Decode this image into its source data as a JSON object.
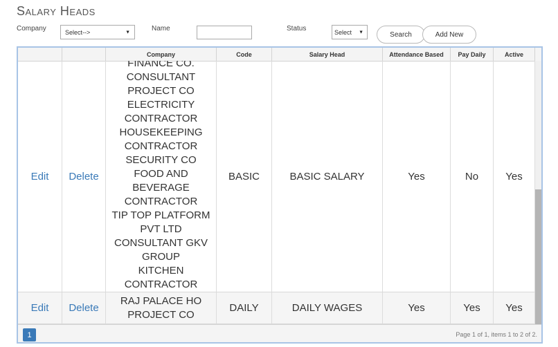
{
  "page": {
    "title": "Salary Heads"
  },
  "filters": {
    "company_label": "Company",
    "company_value": "Select-->",
    "name_label": "Name",
    "name_value": "",
    "status_label": "Status",
    "status_value": "Select",
    "search_label": "Search",
    "add_new_label": "Add New"
  },
  "grid": {
    "columns": [
      "",
      "",
      "Company",
      "Code",
      "Salary Head",
      "Attendance Based",
      "Pay Daily",
      "Active"
    ],
    "rows": [
      {
        "edit": "Edit",
        "delete": "Delete",
        "company_lines": [
          "FINANCE CO.",
          "CONSULTANT",
          "PROJECT CO",
          "ELECTRICITY",
          "CONTRACTOR",
          "HOUSEKEEPING",
          "CONTRACTOR",
          "SECURITY CO",
          "FOOD AND",
          "BEVERAGE",
          "CONTRACTOR",
          "TIP TOP PLATFORM",
          "PVT LTD",
          "CONSULTANT GKV",
          "GROUP",
          "KITCHEN",
          "CONTRACTOR"
        ],
        "code": "BASIC",
        "salary_head": "BASIC SALARY",
        "attendance_based": "Yes",
        "pay_daily": "No",
        "active": "Yes"
      },
      {
        "edit": "Edit",
        "delete": "Delete",
        "company_lines": [
          "RAJ PALACE HO",
          "PROJECT CO"
        ],
        "code": "DAILY",
        "salary_head": "DAILY WAGES",
        "attendance_based": "Yes",
        "pay_daily": "Yes",
        "active": "Yes"
      }
    ]
  },
  "pager": {
    "current_page": "1",
    "info": "Page 1 of 1, items 1 to 2 of 2."
  },
  "colors": {
    "accent": "#3a7ab8",
    "grid_border": "#a8c4e6",
    "header_bg": "#f4f4f4"
  }
}
